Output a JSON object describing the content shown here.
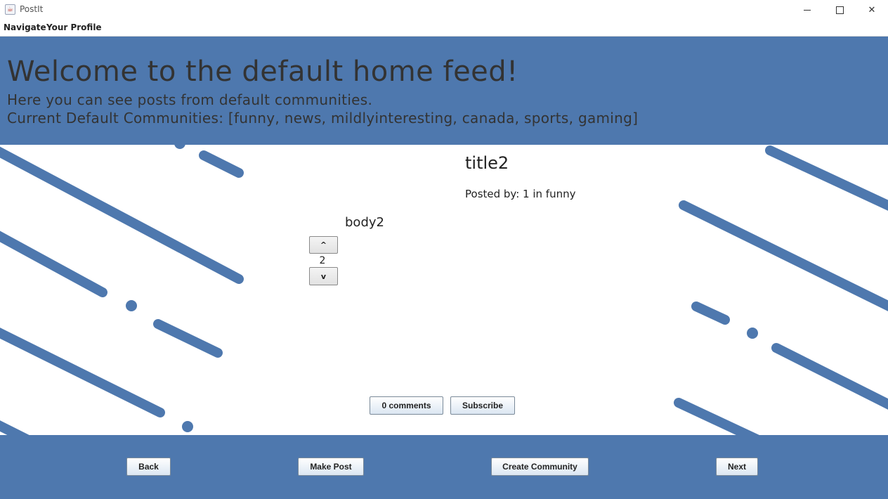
{
  "window": {
    "title": "PostIt",
    "icon": "java-cup-icon",
    "minimize_glyph": "",
    "close_glyph": "✕"
  },
  "menu": {
    "items": [
      {
        "label": "Navigate"
      },
      {
        "label": "Your Profile"
      }
    ]
  },
  "header": {
    "welcome": "Welcome to the default home feed!",
    "subtitle": "Here you can see posts from default communities.",
    "communities": "Current Default Communities: [funny, news, mildlyinteresting, canada, sports, gaming]"
  },
  "post": {
    "title": "title2",
    "meta": "Posted by: 1 in funny",
    "body": "body2",
    "upvote_label": "^",
    "downvote_label": "v",
    "score": "2",
    "comments_label": "0 comments",
    "subscribe_label": "Subscribe"
  },
  "footer": {
    "back_label": "Back",
    "make_post_label": "Make Post",
    "create_community_label": "Create Community",
    "next_label": "Next"
  },
  "colors": {
    "accent": "#4e78ae",
    "text": "#333333",
    "background": "#ffffff"
  }
}
